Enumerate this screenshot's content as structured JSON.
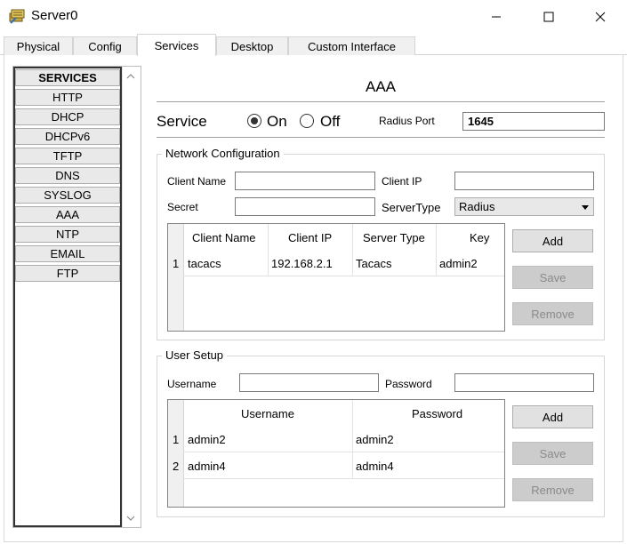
{
  "window": {
    "title": "Server0",
    "icon": "server-icon"
  },
  "tabs": [
    {
      "label": "Physical"
    },
    {
      "label": "Config"
    },
    {
      "label": "Services",
      "active": true
    },
    {
      "label": "Desktop"
    },
    {
      "label": "Custom Interface"
    }
  ],
  "sidebar": {
    "header": "SERVICES",
    "items": [
      "HTTP",
      "DHCP",
      "DHCPv6",
      "TFTP",
      "DNS",
      "SYSLOG",
      "AAA",
      "NTP",
      "EMAIL",
      "FTP"
    ]
  },
  "aaa": {
    "title": "AAA",
    "service_label": "Service",
    "on_label": "On",
    "off_label": "Off",
    "service_state": "On",
    "radius_port_label": "Radius Port",
    "radius_port_value": "1645"
  },
  "network_config": {
    "legend": "Network Configuration",
    "client_name_label": "Client Name",
    "client_name_value": "",
    "client_ip_label": "Client IP",
    "client_ip_value": "",
    "secret_label": "Secret",
    "secret_value": "",
    "server_type_label": "ServerType",
    "server_type_value": "Radius",
    "table": {
      "columns": [
        "Client Name",
        "Client IP",
        "Server Type",
        "Key"
      ],
      "rows": [
        {
          "num": "1",
          "client_name": "tacacs",
          "client_ip": "192.168.2.1",
          "server_type": "Tacacs",
          "key": "admin2"
        }
      ]
    },
    "buttons": {
      "add": "Add",
      "save": "Save",
      "remove": "Remove"
    }
  },
  "user_setup": {
    "legend": "User Setup",
    "username_label": "Username",
    "username_value": "",
    "password_label": "Password",
    "password_value": "",
    "table": {
      "columns": [
        "Username",
        "Password"
      ],
      "rows": [
        {
          "num": "1",
          "username": "admin2",
          "password": "admin2"
        },
        {
          "num": "2",
          "username": "admin4",
          "password": "admin4"
        }
      ]
    },
    "buttons": {
      "add": "Add",
      "save": "Save",
      "remove": "Remove"
    }
  },
  "colors": {
    "button_bg": "#e1e1e1",
    "button_disabled_bg": "#cccccc",
    "disabled_text": "#8a8a8a"
  }
}
